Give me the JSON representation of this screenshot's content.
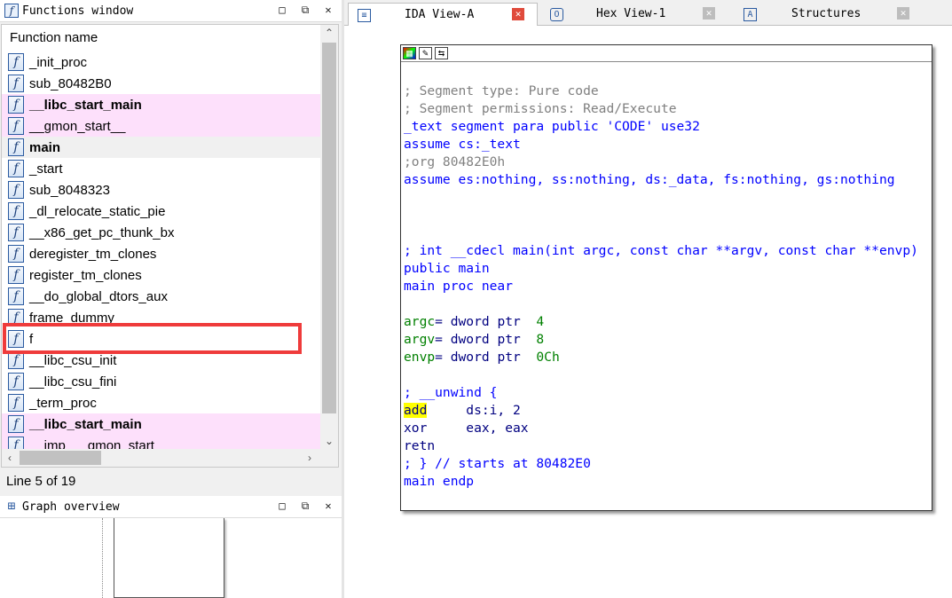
{
  "functions_window": {
    "title": "Functions window",
    "title_buttons": [
      "□",
      "⧉",
      "✕"
    ],
    "column_header": "Function name",
    "items": [
      {
        "name": "_init_proc",
        "style": "normal"
      },
      {
        "name": "sub_80482B0",
        "style": "normal"
      },
      {
        "name": "__libc_start_main",
        "style": "lib"
      },
      {
        "name": "__gmon_start__",
        "style": "lib-plain"
      },
      {
        "name": "main",
        "style": "selected"
      },
      {
        "name": "_start",
        "style": "normal"
      },
      {
        "name": "sub_8048323",
        "style": "normal"
      },
      {
        "name": "_dl_relocate_static_pie",
        "style": "normal"
      },
      {
        "name": "__x86_get_pc_thunk_bx",
        "style": "normal"
      },
      {
        "name": "deregister_tm_clones",
        "style": "normal"
      },
      {
        "name": "register_tm_clones",
        "style": "normal"
      },
      {
        "name": "__do_global_dtors_aux",
        "style": "normal"
      },
      {
        "name": "frame_dummy",
        "style": "normal"
      },
      {
        "name": "f",
        "style": "normal"
      },
      {
        "name": "__libc_csu_init",
        "style": "normal"
      },
      {
        "name": "__libc_csu_fini",
        "style": "normal"
      },
      {
        "name": "_term_proc",
        "style": "normal"
      },
      {
        "name": "__libc_start_main",
        "style": "lib"
      },
      {
        "name": "__imp___gmon_start__",
        "style": "lib-plain"
      }
    ],
    "status": "Line 5 of 19",
    "highlight_color": "#ef3b3b"
  },
  "graph_overview": {
    "title": "Graph overview"
  },
  "tabs": [
    {
      "label": "IDA View-A",
      "active": true,
      "icon": "list-icon"
    },
    {
      "label": "Hex View-1",
      "active": false,
      "icon": "hex-icon"
    },
    {
      "label": "Structures",
      "active": false,
      "icon": "struct-icon"
    }
  ],
  "close_glyph": "✕",
  "icon_glyphs": {
    "function": "f",
    "ida": "≡",
    "hex": "O",
    "struct": "A"
  },
  "code_toolbar": [
    "▦",
    "✎",
    "⇆"
  ],
  "code": {
    "lines": [
      {
        "segments": [
          {
            "t": "; Segment type: Pure code",
            "c": "grey"
          }
        ]
      },
      {
        "segments": [
          {
            "t": "; Segment permissions: Read/Execute",
            "c": "grey"
          }
        ]
      },
      {
        "segments": [
          {
            "t": "_text segment para public 'CODE' use32",
            "c": "blue"
          }
        ]
      },
      {
        "segments": [
          {
            "t": "assume cs:_text",
            "c": "blue"
          }
        ]
      },
      {
        "segments": [
          {
            "t": ";org 80482E0h",
            "c": "grey"
          }
        ]
      },
      {
        "segments": [
          {
            "t": "assume es:nothing, ss:nothing, ds:_data, fs:nothing, gs:nothing",
            "c": "blue"
          }
        ]
      },
      {
        "segments": []
      },
      {
        "segments": []
      },
      {
        "segments": []
      },
      {
        "segments": [
          {
            "t": "; int __cdecl main(int argc, const char **argv, const char **envp)",
            "c": "blue"
          }
        ]
      },
      {
        "segments": [
          {
            "t": "public main",
            "c": "blue"
          }
        ]
      },
      {
        "segments": [
          {
            "t": "main proc near",
            "c": "blue"
          }
        ]
      },
      {
        "segments": []
      },
      {
        "segments": [
          {
            "t": "argc",
            "c": "green"
          },
          {
            "t": "= dword ptr  ",
            "c": "navy"
          },
          {
            "t": "4",
            "c": "green"
          }
        ]
      },
      {
        "segments": [
          {
            "t": "argv",
            "c": "green"
          },
          {
            "t": "= dword ptr  ",
            "c": "navy"
          },
          {
            "t": "8",
            "c": "green"
          }
        ]
      },
      {
        "segments": [
          {
            "t": "envp",
            "c": "green"
          },
          {
            "t": "= dword ptr  ",
            "c": "navy"
          },
          {
            "t": "0Ch",
            "c": "green"
          }
        ]
      },
      {
        "segments": []
      },
      {
        "segments": [
          {
            "t": "; __unwind {",
            "c": "blue"
          }
        ]
      },
      {
        "segments": [
          {
            "t": "add",
            "c": "hl"
          },
          {
            "t": "     ds:i, 2",
            "c": "navy"
          }
        ]
      },
      {
        "segments": [
          {
            "t": "xor     eax, eax",
            "c": "navy"
          }
        ]
      },
      {
        "segments": [
          {
            "t": "retn",
            "c": "navy"
          }
        ]
      },
      {
        "segments": [
          {
            "t": "; } // starts at 80482E0",
            "c": "blue"
          }
        ]
      },
      {
        "segments": [
          {
            "t": "main endp",
            "c": "blue"
          }
        ]
      }
    ]
  }
}
